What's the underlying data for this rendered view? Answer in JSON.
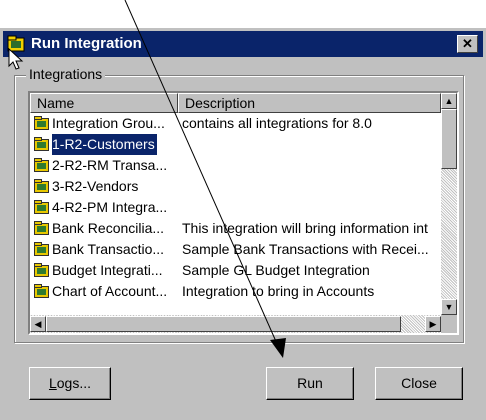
{
  "dialog": {
    "title": "Run Integration",
    "close_glyph": "✕"
  },
  "group": {
    "label": "Integrations"
  },
  "list": {
    "columns": [
      "Name",
      "Description"
    ],
    "rows": [
      {
        "name": "Integration Grou...",
        "desc": "contains all integrations for 8.0",
        "icon": "integration-group-icon"
      },
      {
        "name": "1-R2-Customers",
        "desc": "",
        "icon": "integration-icon",
        "selected": true
      },
      {
        "name": "2-R2-RM Transa...",
        "desc": "",
        "icon": "integration-icon"
      },
      {
        "name": "3-R2-Vendors",
        "desc": "",
        "icon": "integration-icon"
      },
      {
        "name": "4-R2-PM Integra...",
        "desc": "",
        "icon": "integration-icon"
      },
      {
        "name": "Bank Reconcilia...",
        "desc": "This integration will bring information int",
        "icon": "integration-icon"
      },
      {
        "name": "Bank Transactio...",
        "desc": "Sample Bank Transactions with Recei...",
        "icon": "integration-icon"
      },
      {
        "name": "Budget Integrati...",
        "desc": "Sample GL Budget Integration",
        "icon": "integration-icon"
      },
      {
        "name": "Chart of Account...",
        "desc": "Integration to bring in Accounts",
        "icon": "integration-icon"
      }
    ]
  },
  "buttons": {
    "logs": {
      "underline": "L",
      "rest": "ogs..."
    },
    "run": "Run",
    "close": "Close"
  },
  "colors": {
    "titlebar": "#0a246a",
    "face": "#c0c0c0",
    "selection": "#0a246a"
  }
}
